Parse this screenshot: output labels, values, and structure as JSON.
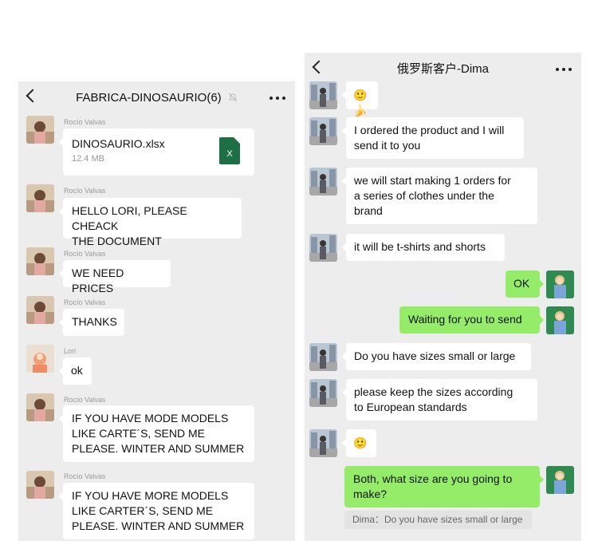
{
  "left_chat": {
    "title": "FABRICA-DINOSAURIO(6)",
    "file": {
      "name": "DINOSAURIO.xlsx",
      "size": "12.4 MB",
      "icon_letter": "X"
    },
    "messages": [
      {
        "sender": "Rocío Valvas"
      },
      {
        "sender": "Rocío Valvas",
        "text": "HELLO LORI, PLEASE CHEACK\nTHE DOCUMENT"
      },
      {
        "sender": "Rocío Valvas",
        "text": "WE NEED PRICES"
      },
      {
        "sender": "Rocío Valvas",
        "text": "THANKS"
      },
      {
        "sender": "Lori",
        "text": "ok"
      },
      {
        "sender": "Rocío Valvas",
        "text": "IF YOU HAVE MODE MODELS\nLIKE CARTE´S, SEND ME\nPLEASE.  WINTER AND SUMMER"
      },
      {
        "sender": "Rocío Valvas",
        "text": "IF YOU HAVE MORE MODELS\nLIKE CARTER´S, SEND ME\nPLEASE. WINTER AND SUMMER"
      }
    ]
  },
  "right_chat": {
    "title": "俄罗斯客户-Dima",
    "messages": [
      {
        "from": "them",
        "text": "🙂🍌"
      },
      {
        "from": "them",
        "text": "I ordered the product and I will\nsend it to you"
      },
      {
        "from": "them",
        "text": "we will start making 1 orders for\na series of clothes under the\nbrand"
      },
      {
        "from": "them",
        "text": "it will be t-shirts and shorts"
      },
      {
        "from": "me",
        "text": "OK"
      },
      {
        "from": "me",
        "text": "Waiting for you to send"
      },
      {
        "from": "them",
        "text": "Do you have sizes small or large"
      },
      {
        "from": "them",
        "text": "please keep the sizes according\nto European standards"
      },
      {
        "from": "them",
        "text": "🙂"
      },
      {
        "from": "me",
        "text": "Both, what size are you going to\nmake?"
      }
    ],
    "quote": "Dima：Do you have sizes small or large"
  },
  "colors": {
    "bubble_out": "#95ec69",
    "bubble_in": "#ffffff",
    "background": "#ededed",
    "excel": "#1d7044"
  },
  "icons": [
    "back-arrow-icon",
    "mute-bell-icon",
    "more-dots-icon",
    "excel-file-icon"
  ]
}
